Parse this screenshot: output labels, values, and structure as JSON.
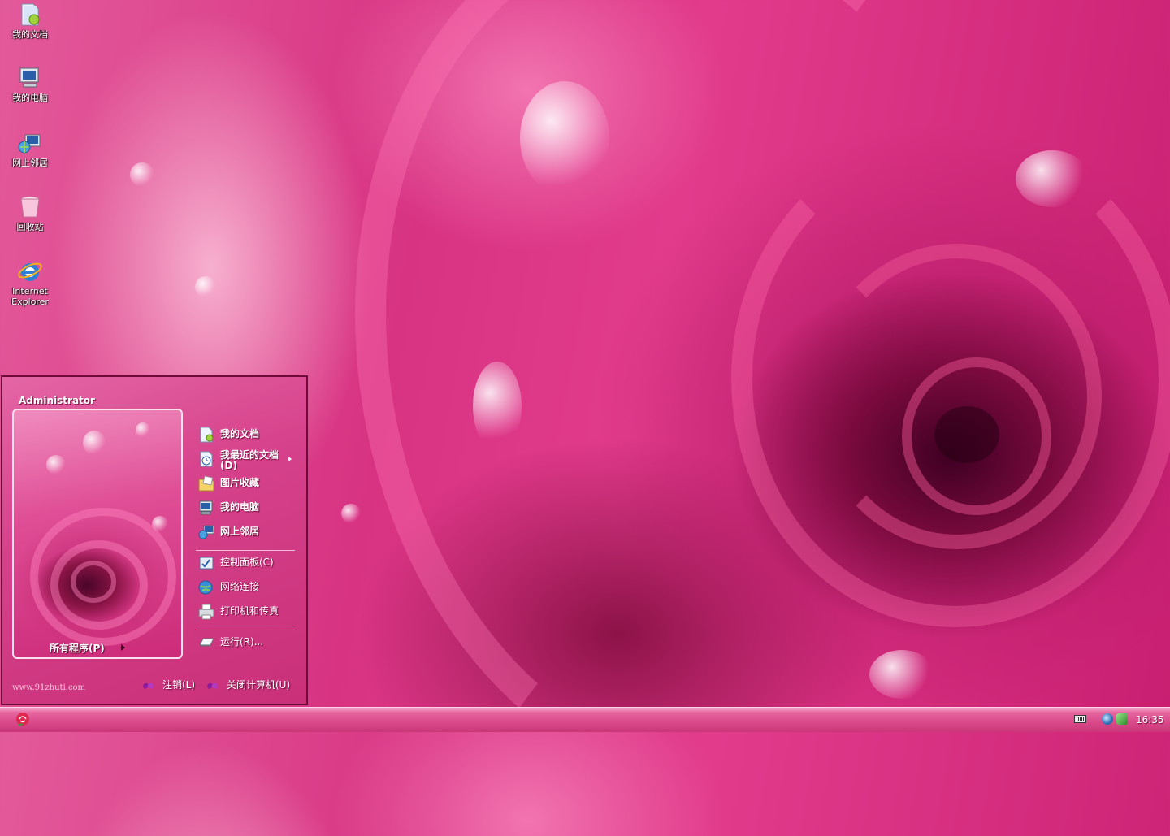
{
  "desktop": {
    "icons": [
      {
        "label": "我的文档",
        "icon": "my-documents-icon"
      },
      {
        "label": "我的电脑",
        "icon": "my-computer-icon"
      },
      {
        "label": "网上邻居",
        "icon": "network-places-icon"
      },
      {
        "label": "回收站",
        "icon": "recycle-bin-icon"
      },
      {
        "label": "Internet Explorer",
        "icon": "internet-explorer-icon"
      }
    ]
  },
  "start_menu": {
    "user_name": "Administrator",
    "all_programs": "所有程序(P)",
    "places": [
      {
        "label": "我的文档",
        "icon": "my-documents-icon"
      },
      {
        "label": "我最近的文档(D)",
        "icon": "recent-documents-icon"
      },
      {
        "label": "图片收藏",
        "icon": "my-pictures-icon"
      },
      {
        "label": "我的电脑",
        "icon": "my-computer-icon"
      },
      {
        "label": "网上邻居",
        "icon": "network-places-icon"
      }
    ],
    "settings": [
      {
        "label": "控制面板(C)",
        "icon": "control-panel-icon"
      },
      {
        "label": "网络连接",
        "icon": "network-connections-icon"
      },
      {
        "label": "打印机和传真",
        "icon": "printers-icon"
      }
    ],
    "run": {
      "label": "运行(R)...",
      "icon": "run-icon"
    },
    "watermark": "www.91zhuti.com",
    "logoff": "注销(L)",
    "shutdown": "关闭计算机(U)"
  },
  "taskbar": {
    "clock": "16:35"
  },
  "colors": {
    "accent": "#d6418b",
    "taskbar": "#da4a8a",
    "border": "#6e0a38"
  }
}
